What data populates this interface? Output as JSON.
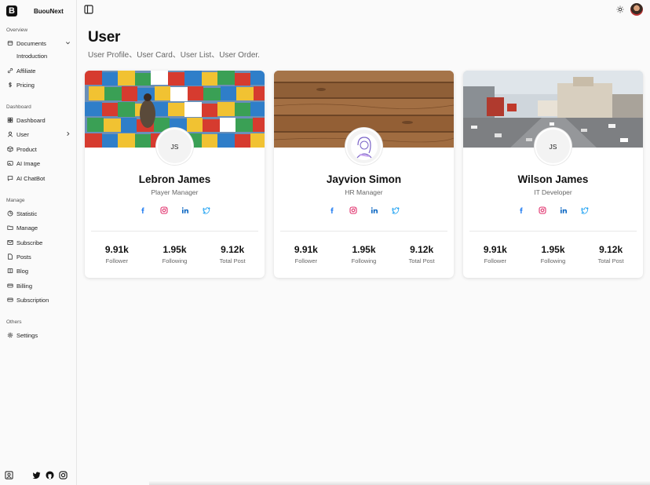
{
  "brand": {
    "logo_letter": "B",
    "name": "BuouNext"
  },
  "sidebar": {
    "sections": [
      {
        "title": "Overview"
      },
      {
        "title": "Dashboard"
      },
      {
        "title": "Manage"
      },
      {
        "title": "Others"
      }
    ],
    "items": [
      {
        "label": "Documents",
        "icon": "document-icon"
      },
      {
        "label": "Introduction",
        "icon": ""
      },
      {
        "label": "Affiliate",
        "icon": "link-icon"
      },
      {
        "label": "Pricing",
        "icon": "dollar-icon"
      },
      {
        "label": "Dashboard",
        "icon": "grid-icon"
      },
      {
        "label": "User",
        "icon": "user-icon"
      },
      {
        "label": "Product",
        "icon": "cube-icon"
      },
      {
        "label": "AI Image",
        "icon": "image-icon"
      },
      {
        "label": "AI ChatBot",
        "icon": "chat-icon"
      },
      {
        "label": "Statistic",
        "icon": "chart-icon"
      },
      {
        "label": "Manage",
        "icon": "folder-icon"
      },
      {
        "label": "Subscribe",
        "icon": "mail-icon"
      },
      {
        "label": "Posts",
        "icon": "file-icon"
      },
      {
        "label": "Blog",
        "icon": "book-icon"
      },
      {
        "label": "Billing",
        "icon": "card-icon"
      },
      {
        "label": "Subscription",
        "icon": "card-icon"
      },
      {
        "label": "Settings",
        "icon": "gear-icon"
      }
    ]
  },
  "header": {
    "title": "User",
    "subtitle": "User Profile、User Card、User List、User Order."
  },
  "cards": [
    {
      "initials": "JS",
      "name": "Lebron James",
      "role": "Player Manager",
      "stats": [
        {
          "value": "9.91k",
          "label": "Follower"
        },
        {
          "value": "1.95k",
          "label": "Following"
        },
        {
          "value": "9.12k",
          "label": "Total Post"
        }
      ]
    },
    {
      "initials": "",
      "name": "Jayvion Simon",
      "role": "HR Manager",
      "stats": [
        {
          "value": "9.91k",
          "label": "Follower"
        },
        {
          "value": "1.95k",
          "label": "Following"
        },
        {
          "value": "9.12k",
          "label": "Total Post"
        }
      ]
    },
    {
      "initials": "JS",
      "name": "Wilson James",
      "role": "IT Developer",
      "stats": [
        {
          "value": "9.91k",
          "label": "Follower"
        },
        {
          "value": "1.95k",
          "label": "Following"
        },
        {
          "value": "9.12k",
          "label": "Total Post"
        }
      ]
    }
  ],
  "colors": {
    "facebook": "#1877f2",
    "instagram": "#e1306c",
    "linkedin": "#0a66c2",
    "twitter": "#1da1f2"
  }
}
